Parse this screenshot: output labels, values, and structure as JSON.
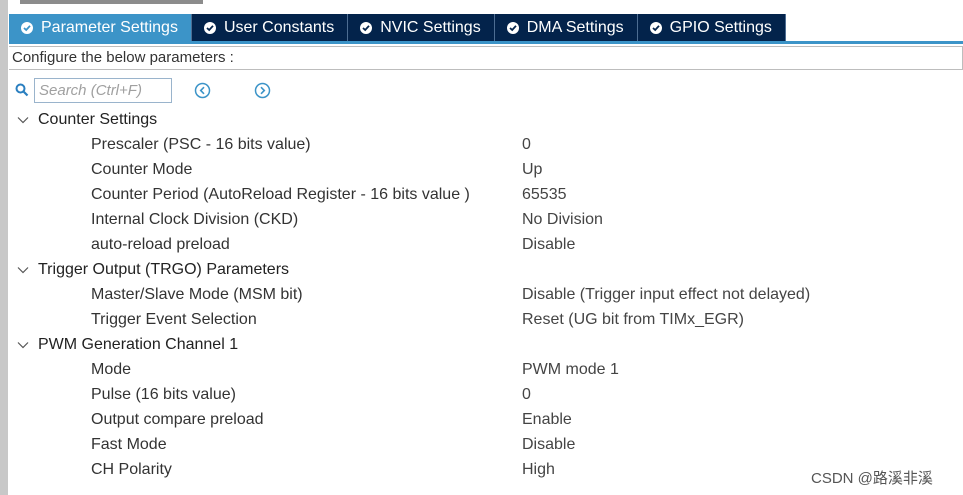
{
  "tabs": [
    {
      "label": "Parameter Settings",
      "icon": "check-circle-icon",
      "active": true
    },
    {
      "label": "User Constants",
      "icon": "check-circle-icon",
      "active": false
    },
    {
      "label": "NVIC Settings",
      "icon": "check-circle-icon",
      "active": false
    },
    {
      "label": "DMA Settings",
      "icon": "check-circle-icon",
      "active": false
    },
    {
      "label": "GPIO Settings",
      "icon": "check-circle-icon",
      "active": false
    }
  ],
  "config_label": "Configure the below parameters :",
  "search": {
    "placeholder": "Search (Ctrl+F)",
    "value": ""
  },
  "groups": [
    {
      "label": "Counter Settings",
      "params": [
        {
          "name": "Prescaler (PSC - 16 bits value)",
          "value": "0"
        },
        {
          "name": "Counter Mode",
          "value": "Up"
        },
        {
          "name": "Counter Period (AutoReload Register - 16 bits value )",
          "value": "65535"
        },
        {
          "name": "Internal Clock Division (CKD)",
          "value": "No Division"
        },
        {
          "name": "auto-reload preload",
          "value": "Disable"
        }
      ]
    },
    {
      "label": "Trigger Output (TRGO) Parameters",
      "params": [
        {
          "name": "Master/Slave Mode (MSM bit)",
          "value": "Disable (Trigger input effect not delayed)"
        },
        {
          "name": "Trigger Event Selection",
          "value": "Reset (UG bit from TIMx_EGR)"
        }
      ]
    },
    {
      "label": "PWM Generation Channel 1",
      "params": [
        {
          "name": "Mode",
          "value": "PWM mode 1"
        },
        {
          "name": "Pulse (16 bits value)",
          "value": "0"
        },
        {
          "name": "Output compare preload",
          "value": "Enable"
        },
        {
          "name": "Fast Mode",
          "value": "Disable"
        },
        {
          "name": "CH Polarity",
          "value": "High"
        }
      ]
    }
  ],
  "watermark": "CSDN @路溪非溪",
  "colors": {
    "tab_bg": "#03234b",
    "tab_active_bg": "#3c94c8",
    "accent": "#3c94c8",
    "search_icon": "#2a7fc0"
  }
}
